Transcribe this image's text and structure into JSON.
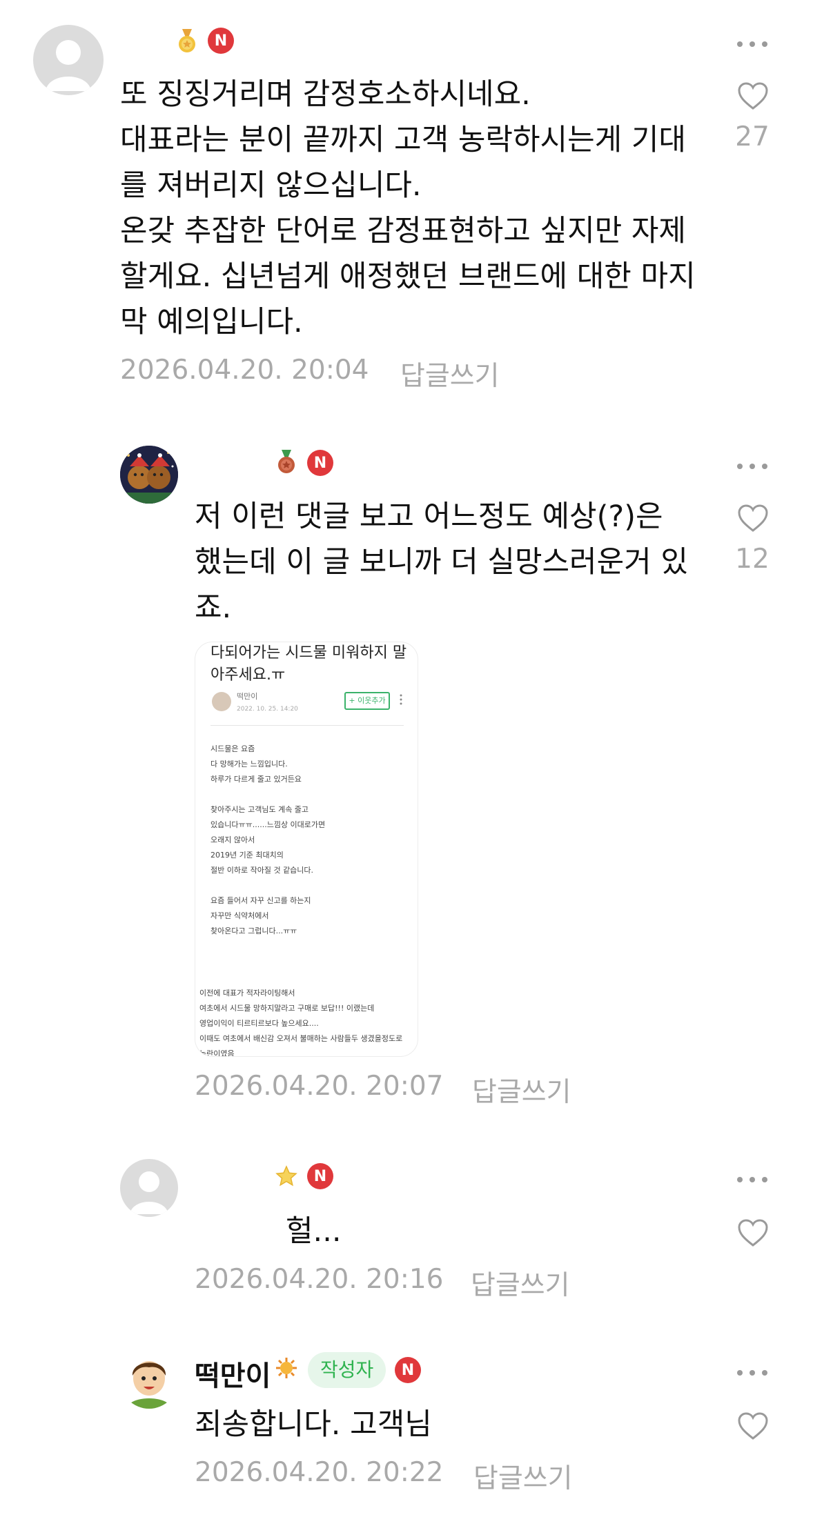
{
  "comments": [
    {
      "text": "또 징징거리며 감정호소하시네요.\n대표라는 분이 끝까지 고객 농락하시는게 기대를 져버리지 않으십니다.\n온갖 추잡한 단어로 감정표현하고 싶지만 자제할게요. 십년넘게 애정했던 브랜드에 대한 마지막 예의입니다.",
      "date": "2026.04.20. 20:04",
      "reply_label": "답글쓰기",
      "likes": "27",
      "badge_icon": "gold-medal-icon",
      "n_badge": "N"
    },
    {
      "text": "저 이런 댓글 보고 어느정도 예상(?)은 했는데 이 글 보니까 더 실망스러운거 있죠.",
      "date": "2026.04.20. 20:07",
      "reply_label": "답글쓰기",
      "likes": "12",
      "badge_icon": "bronze-medal-icon",
      "n_badge": "N",
      "embed": {
        "title": "다되어가는 시드물 미워하지 말\n아주세요.ㅠ",
        "author": "떡만이",
        "date": "2022. 10. 25. 14:20",
        "follow_label": "+ 이웃추가",
        "body1": "시드물은 요즘\n다 망해가는 느낌입니다.\n하루가 다르게 줄고 있거든요\n\n찾아주시는 고객님도 계속 줄고\n있습니다ㅠㅠ......느낌상 이대로가면\n오래지 않아서\n2019년 기준 최대치의\n절반 이하로 작아질 것 같습니다.\n\n요즘 들어서 자꾸 신고를 하는지\n자꾸만 식약처에서\n찾아온다고 그럽니다...ㅠㅠ",
        "body2": "이전에 대표가 적자라이팅해서\n여초에서 시드물 망하지말라고 구매로 보답!!! 이랬는데\n영업이익이 티르티르보다 높으세요....\n이때도 여초에서 배신감 오져서 불매하는 사람들두 생겼을정도로\n논란이였음"
      }
    },
    {
      "text": "헐...",
      "date": "2026.04.20. 20:16",
      "reply_label": "답글쓰기",
      "badge_icon": "star-icon",
      "n_badge": "N"
    },
    {
      "name": "떡만이",
      "author_tag": "작성자",
      "text": "죄송합니다. 고객님",
      "date": "2026.04.20. 20:22",
      "reply_label": "답글쓰기",
      "badge_icon": "sun-badge-icon",
      "n_badge": "N"
    }
  ],
  "colors": {
    "n_badge": "#e0383b",
    "author_tag_bg": "#e6f6ea",
    "author_tag_text": "#2fb34f",
    "meta_text": "#a9a9a9"
  }
}
